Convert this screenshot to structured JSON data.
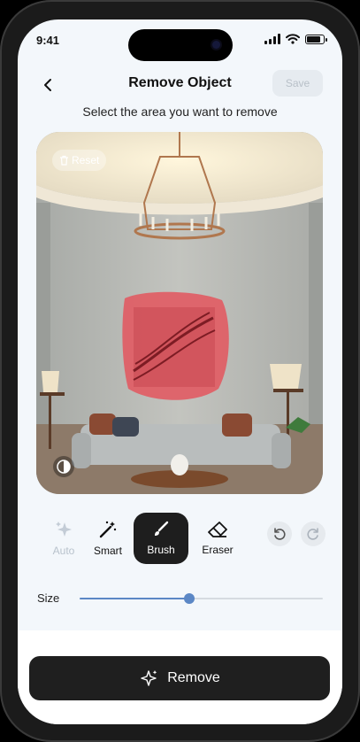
{
  "status": {
    "time": "9:41"
  },
  "header": {
    "title": "Remove Object",
    "save_label": "Save"
  },
  "instruction": "Select the area you want to remove",
  "canvas": {
    "reset_label": "Reset"
  },
  "tools": [
    {
      "label": "Auto",
      "icon": "sparkles-icon",
      "state": "disabled"
    },
    {
      "label": "Smart",
      "icon": "magic-wand-icon",
      "state": "normal"
    },
    {
      "label": "Brush",
      "icon": "brush-icon",
      "state": "active"
    },
    {
      "label": "Eraser",
      "icon": "eraser-icon",
      "state": "normal"
    }
  ],
  "size": {
    "label": "Size",
    "value": 0.45
  },
  "action": {
    "remove_label": "Remove"
  },
  "colors": {
    "accent": "#5b87c5",
    "dark": "#1f1f1f",
    "mask": "#e15b63"
  }
}
